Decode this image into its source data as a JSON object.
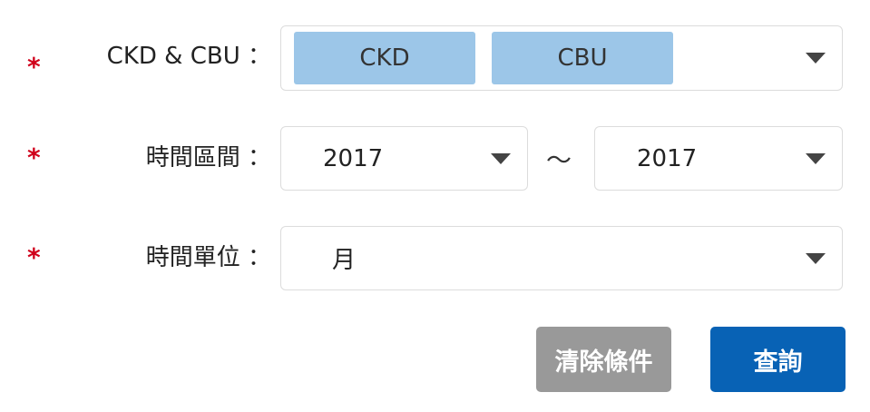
{
  "form": {
    "required_mark": "*",
    "ckd_cbu": {
      "label": "CKD & CBU ：",
      "tags": [
        "CKD",
        "CBU"
      ]
    },
    "period": {
      "label": "時間區間 ：",
      "start": "2017",
      "separator": "～",
      "end": "2017"
    },
    "unit": {
      "label": "時間單位 ：",
      "value": "月"
    }
  },
  "actions": {
    "clear_label": "清除條件",
    "search_label": "查詢"
  },
  "colors": {
    "required": "#d0021b",
    "tag_bg": "#9cc6e8",
    "clear_bg": "#999999",
    "search_bg": "#0862b5"
  },
  "icons": {
    "dropdown": "caret-down-icon"
  }
}
